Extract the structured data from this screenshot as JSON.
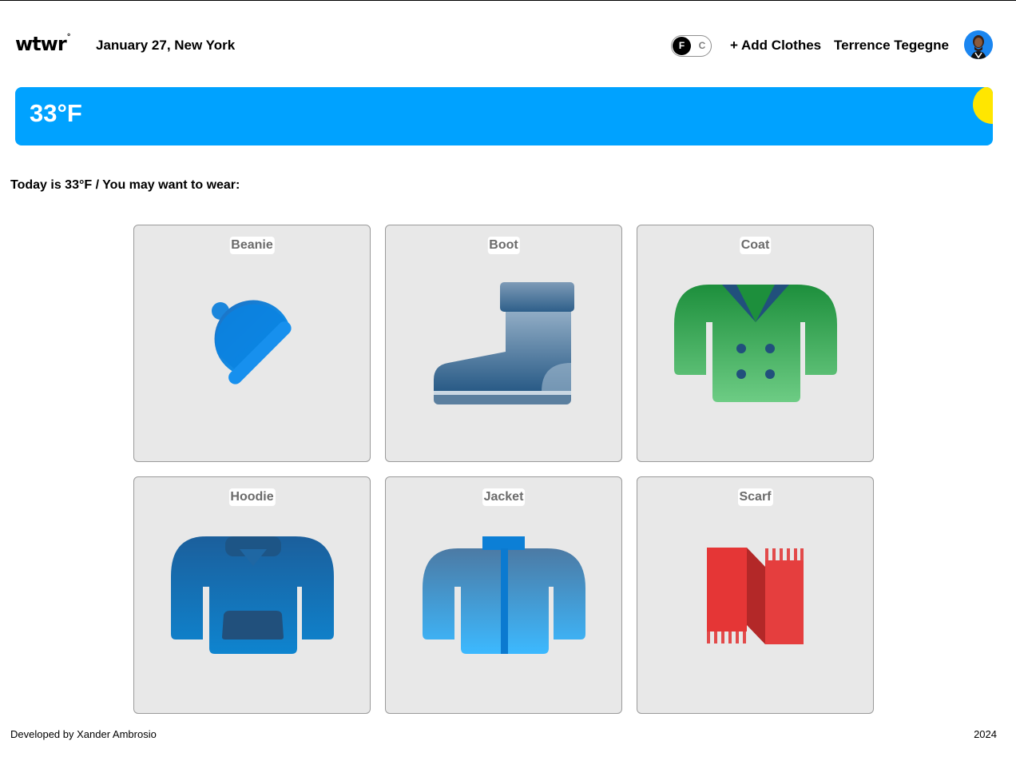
{
  "header": {
    "logo": "wtwr",
    "logo_mark": "°",
    "date_location": "January 27, New York",
    "unit_toggle": {
      "selected": "F",
      "other": "C"
    },
    "add_clothes_label": "+ Add Clothes",
    "user_name": "Terrence Tegegne"
  },
  "weather": {
    "temperature": "33°F",
    "condition_icon": "sun-icon",
    "colors": {
      "card": "#00a2ff",
      "sun": "#ffe600"
    }
  },
  "main": {
    "suggestion": "Today is 33°F / You may want to wear:",
    "items": [
      {
        "name": "Beanie",
        "icon": "beanie-icon"
      },
      {
        "name": "Boot",
        "icon": "boot-icon"
      },
      {
        "name": "Coat",
        "icon": "coat-icon"
      },
      {
        "name": "Hoodie",
        "icon": "hoodie-icon"
      },
      {
        "name": "Jacket",
        "icon": "jacket-icon"
      },
      {
        "name": "Scarf",
        "icon": "scarf-icon"
      }
    ]
  },
  "footer": {
    "credit": "Developed by Xander Ambrosio",
    "year": "2024"
  }
}
